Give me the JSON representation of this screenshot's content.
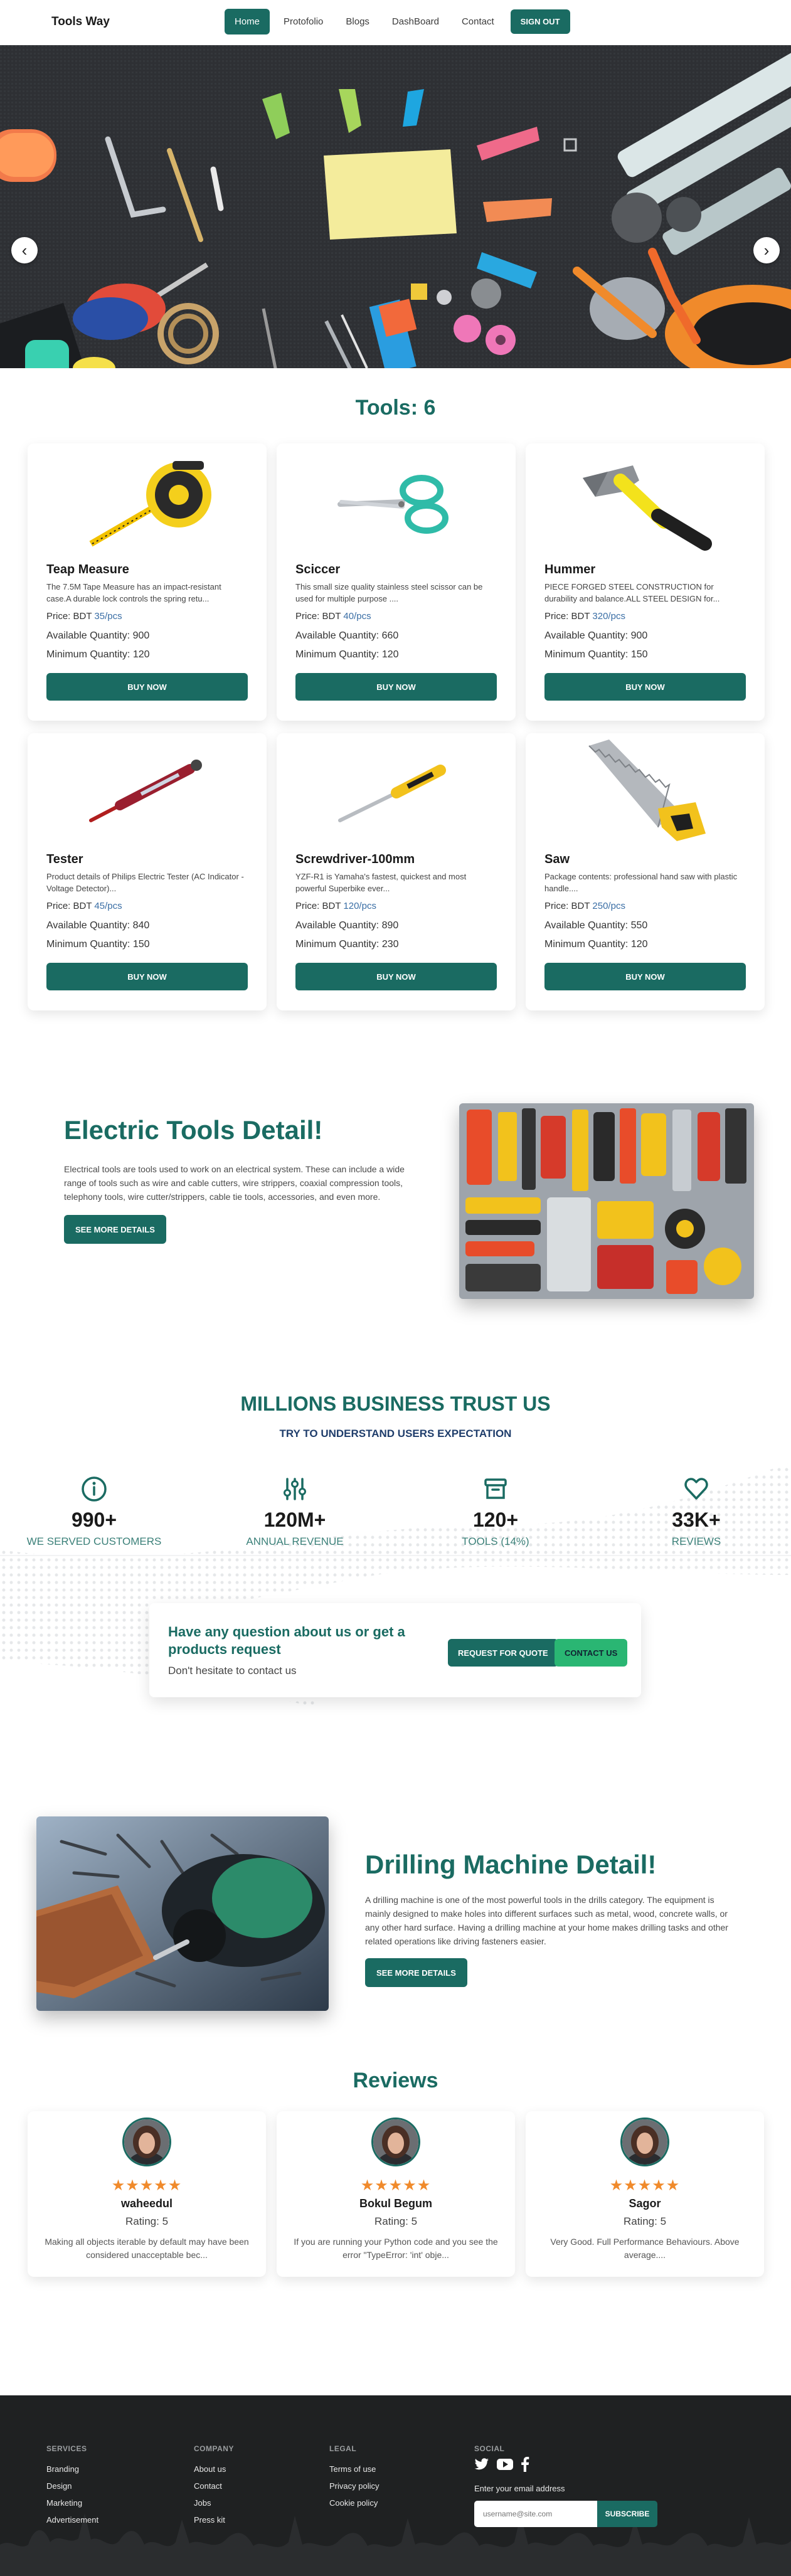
{
  "navbar": {
    "brand": "Tools Way",
    "links": [
      {
        "label": "Home",
        "active": true
      },
      {
        "label": "Protofolio"
      },
      {
        "label": "Blogs"
      },
      {
        "label": "DashBoard"
      },
      {
        "label": "Contact"
      }
    ],
    "signout": "Sign Out"
  },
  "hero": {
    "prev_icon": "chevron-left-icon",
    "next_icon": "chevron-right-icon"
  },
  "tools": {
    "title": "Tools: 6",
    "price_prefix": "Price: BDT ",
    "qty_prefix": "Available Quantity: ",
    "min_prefix": "Minimum Quantity: ",
    "buy_label": "Buy Now",
    "items": [
      {
        "name": "Teap Measure",
        "description": "The 7.5M Tape Measure has an impact-resistant case.A durable lock controls the spring retu...",
        "price": "35/pcs",
        "available": "900",
        "minimum": "120",
        "icon": "tape-measure-icon"
      },
      {
        "name": "Sciccer",
        "description": "This small size quality stainless steel scissor can be used for multiple purpose ....",
        "price": "40/pcs",
        "available": "660",
        "minimum": "120",
        "icon": "scissors-icon"
      },
      {
        "name": "Hummer",
        "description": "PIECE FORGED STEEL CONSTRUCTION for durability and balance.ALL STEEL DESIGN for...",
        "price": "320/pcs",
        "available": "900",
        "minimum": "150",
        "icon": "hammer-icon"
      },
      {
        "name": "Tester",
        "description": "Product details of Philips Electric Tester (AC Indicator - Voltage Detector)...",
        "price": "45/pcs",
        "available": "840",
        "minimum": "150",
        "icon": "voltage-tester-icon"
      },
      {
        "name": "Screwdriver-100mm",
        "description": "YZF-R1 is Yamaha's fastest, quickest and most powerful Superbike ever...",
        "price": "120/pcs",
        "available": "890",
        "minimum": "230",
        "icon": "screwdriver-icon"
      },
      {
        "name": "Saw",
        "description": "Package contents: professional hand saw with plastic handle....",
        "price": "250/pcs",
        "available": "550",
        "minimum": "120",
        "icon": "hand-saw-icon"
      }
    ]
  },
  "electric": {
    "title": "Electric Tools Detail!",
    "text": "Electrical tools are tools used to work on an electrical system. These can include a wide range of tools such as wire and cable cutters, wire strippers, coaxial compression tools, telephony tools, wire cutter/strippers, cable tie tools, accessories, and even more.",
    "button": "See More Details"
  },
  "trust": {
    "title": "MILLIONS BUSINESS TRUST US",
    "subtitle": "TRY TO UNDERSTAND USERS EXPECTATION",
    "stats": [
      {
        "value": "990+",
        "label": "We Served Customers",
        "icon": "info-circle-icon"
      },
      {
        "value": "120M+",
        "label": "Annual Revenue",
        "icon": "sliders-icon"
      },
      {
        "value": "120+",
        "label": "Tools (14%)",
        "icon": "archive-box-icon"
      },
      {
        "value": "33K+",
        "label": "Reviews",
        "icon": "heart-icon"
      }
    ],
    "question": "Have any question about us or get a products request",
    "hint": "Don't hesitate to contact us",
    "request_btn": "Request For Quote",
    "contact_btn": "Contact Us"
  },
  "drilling": {
    "title": "Drilling Machine Detail!",
    "text": "A drilling machine is one of the most powerful tools in the drills category. The equipment is mainly designed to make holes into different surfaces such as metal, wood, concrete walls, or any other hard surface. Having a drilling machine at your home makes drilling tasks and other related operations like driving fasteners easier.",
    "button": "See More Details"
  },
  "reviews": {
    "title": "Reviews",
    "stars": "★★★★★",
    "rating_prefix": "Rating: ",
    "items": [
      {
        "name": "waheedul",
        "rating": "5",
        "text": "Making all objects iterable by default may have been considered unacceptable bec..."
      },
      {
        "name": "Bokul Begum",
        "rating": "5",
        "text": "If you are running your Python code and you see the error \"TypeError: 'int' obje..."
      },
      {
        "name": "Sagor",
        "rating": "5",
        "text": "Very Good. Full Performance Behaviours. Above average...."
      }
    ]
  },
  "footer": {
    "services": {
      "title": "Services",
      "links": [
        "Branding",
        "Design",
        "Marketing",
        "Advertisement"
      ]
    },
    "company": {
      "title": "Company",
      "links": [
        "About us",
        "Contact",
        "Jobs",
        "Press kit"
      ]
    },
    "legal": {
      "title": "Legal",
      "links": [
        "Terms of use",
        "Privacy policy",
        "Cookie policy"
      ]
    },
    "social": {
      "title": "Social",
      "icons": [
        "twitter-icon",
        "youtube-icon",
        "facebook-icon"
      ]
    },
    "email_label": "Enter your email address",
    "email_placeholder": "username@site.com",
    "subscribe": "Subscribe"
  },
  "colors": {
    "primary": "#1a6b62",
    "accent_green": "#2ab673",
    "footer_bg": "#1f2122",
    "star": "#f08a2b"
  }
}
